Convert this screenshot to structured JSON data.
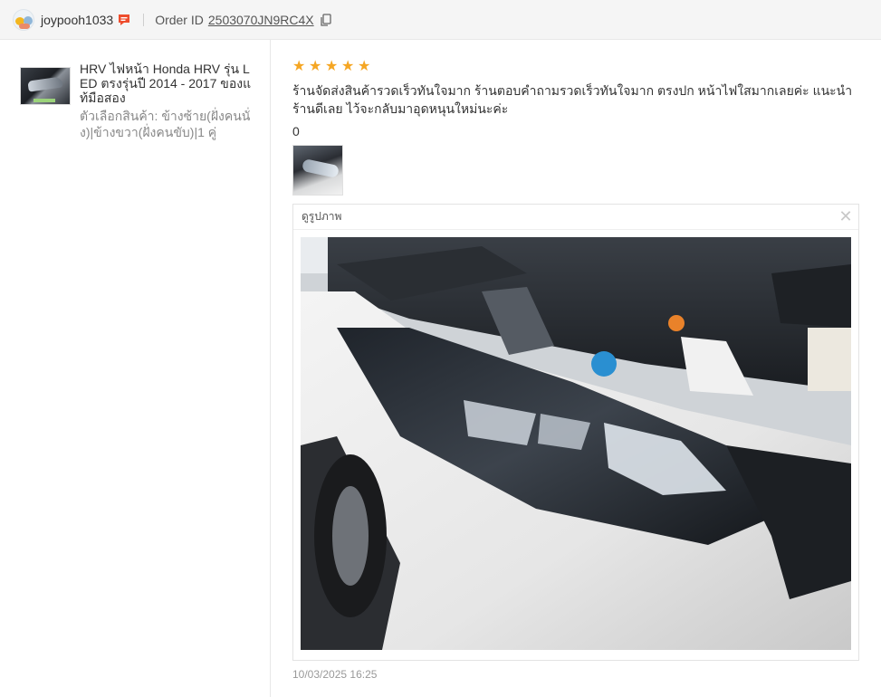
{
  "header": {
    "username": "joypooh1033",
    "order_label": "Order ID",
    "order_id": "2503070JN9RC4X"
  },
  "product": {
    "title": "HRV ไฟหน้า Honda HRV รุ่น LED ตรงรุ่นปี 2014 - 2017 ของแท้มือสอง",
    "variant": "ตัวเลือกสินค้า: ข้างซ้าย(ฝั่งคนนั่ง)|ข้างขวา(ฝั่งคนขับ)|1 คู่"
  },
  "review": {
    "rating": 5,
    "stars": [
      "★",
      "★",
      "★",
      "★",
      "★"
    ],
    "text": "ร้านจัดส่งสินค้ารวดเร็วทันใจมาก ร้านตอบคำถามรวดเร็วทันใจมาก ตรงปก หน้าไฟใสมากเลยค่ะ แนะนำร้านดีเลย ไว้จะกลับมาอุดหนุนใหม่นะค่ะ",
    "likes": "0",
    "timestamp": "10/03/2025 16:25"
  },
  "viewer": {
    "title": "ดูรูปภาพ",
    "close_glyph": "✕"
  },
  "colors": {
    "star": "#f5a623",
    "chat_icon": "#ee4d2d",
    "header_bg": "#f5f5f5"
  },
  "icons": {
    "chat": "chat-icon",
    "copy": "copy-icon",
    "close": "close-icon"
  }
}
